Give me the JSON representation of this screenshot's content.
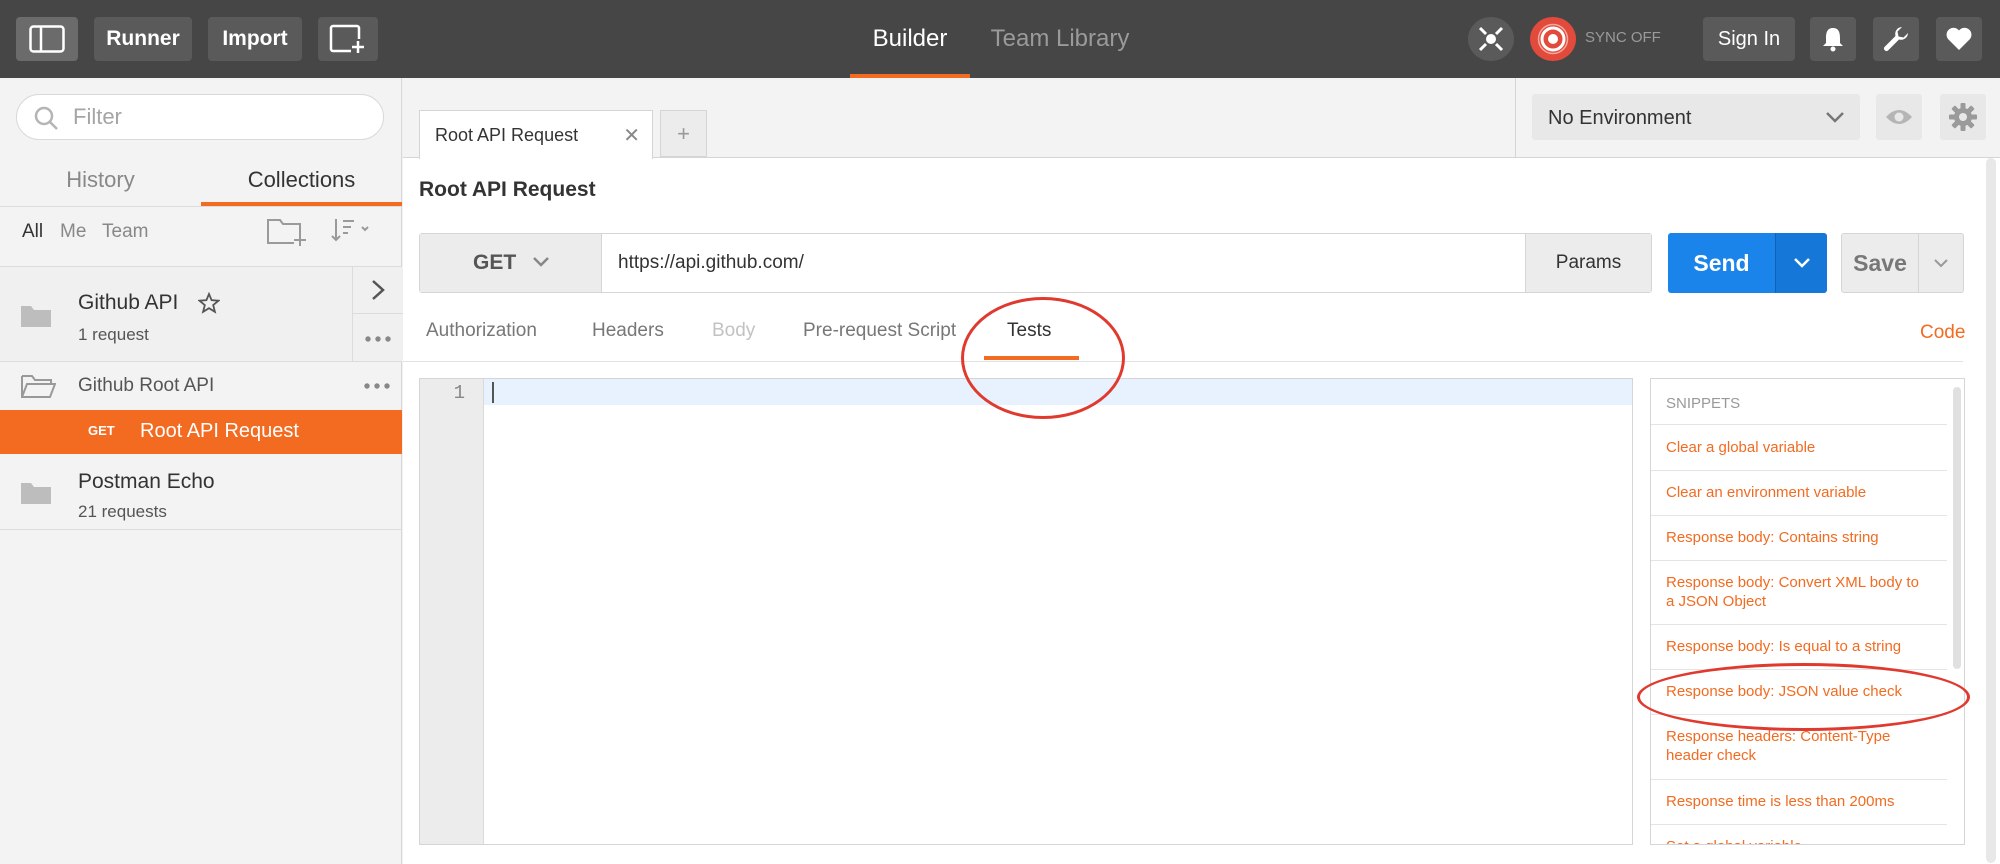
{
  "topbar": {
    "runner_label": "Runner",
    "import_label": "Import",
    "tabs": {
      "builder": "Builder",
      "team_library": "Team Library"
    },
    "sync_label": "SYNC OFF",
    "sign_in_label": "Sign In",
    "colors": {
      "bar": "#464646",
      "accent": "#f26b21",
      "sync": "#e24a3b"
    }
  },
  "sidebar": {
    "filter_placeholder": "Filter",
    "tabs": {
      "history": "History",
      "collections": "Collections"
    },
    "owner_filters": [
      "All",
      "Me",
      "Team"
    ],
    "collections": [
      {
        "name": "Github API",
        "count": "1 request"
      },
      {
        "name": "Postman Echo",
        "count": "21 requests"
      }
    ],
    "folder": {
      "name": "Github Root API"
    },
    "active_request": {
      "method": "GET",
      "name": "Root API Request"
    }
  },
  "main": {
    "open_tab": "Root API Request",
    "add_tab": "+",
    "close_glyph": "✕",
    "environment": "No Environment",
    "request_title": "Root API Request",
    "method": "GET",
    "url": "https://api.github.com/",
    "params_label": "Params",
    "send_label": "Send",
    "save_label": "Save",
    "sub_tabs": [
      "Authorization",
      "Headers",
      "Body",
      "Pre-request Script",
      "Tests"
    ],
    "active_sub_tab": "Tests",
    "code_link": "Code",
    "editor": {
      "line_number": "1"
    }
  },
  "snippets": {
    "header": "SNIPPETS",
    "items": [
      "Clear a global variable",
      "Clear an environment variable",
      "Response body: Contains string",
      "Response body: Convert XML body to a JSON Object",
      "Response body: Is equal to a string",
      "Response body: JSON value check",
      "Response headers: Content-Type header check",
      "Response time is less than 200ms",
      "Set a global variable"
    ]
  },
  "annotations": {
    "color": "#e03a2f",
    "highlighted": [
      "Tests",
      "Response body: JSON value check"
    ]
  }
}
